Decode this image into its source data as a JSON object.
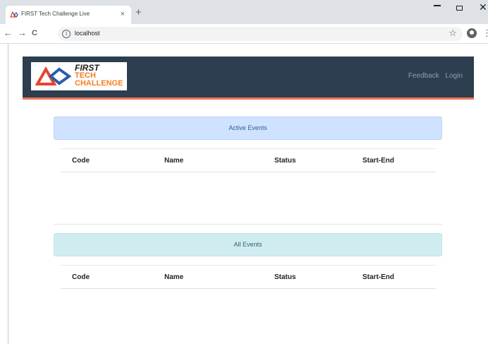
{
  "browser": {
    "tab_title": "FIRST Tech Challenge Live",
    "close_glyph": "×",
    "new_tab_glyph": "+",
    "url": "localhost",
    "info_glyph": "i",
    "back_glyph": "←",
    "forward_glyph": "→",
    "reload_glyph": "C",
    "star_glyph": "☆",
    "menu_glyph": "⋮",
    "window_close_glyph": "✕"
  },
  "header": {
    "logo": {
      "line1": "FIRST",
      "line2": "TECH",
      "line3": "CHALLENGE"
    },
    "nav": [
      "Feedback",
      "Login"
    ],
    "accent": "#f0745a",
    "background": "#2c3e50"
  },
  "sections": {
    "active": {
      "title": "Active Events",
      "columns": [
        "Code",
        "Name",
        "Status",
        "Start-End"
      ]
    },
    "all": {
      "title": "All Events",
      "columns": [
        "Code",
        "Name",
        "Status",
        "Start-End"
      ]
    }
  }
}
